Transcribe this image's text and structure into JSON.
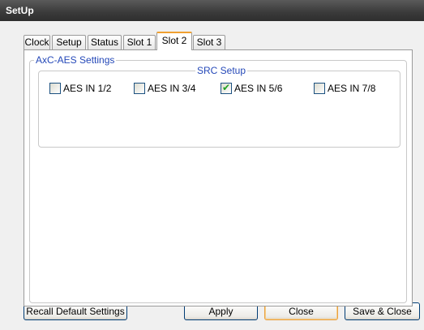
{
  "window": {
    "title": "SetUp"
  },
  "tabs": [
    {
      "label": "Clock"
    },
    {
      "label": "Setup"
    },
    {
      "label": "Status"
    },
    {
      "label": "Slot 1"
    },
    {
      "label": "Slot 2",
      "active": true
    },
    {
      "label": "Slot 3"
    }
  ],
  "panel": {
    "group_title": "AxC-AES Settings",
    "src_group": {
      "title": "SRC Setup",
      "checkboxes": [
        {
          "label": "AES IN 1/2",
          "checked": false
        },
        {
          "label": "AES IN 3/4",
          "checked": false
        },
        {
          "label": "AES IN 5/6",
          "checked": true
        },
        {
          "label": "AES IN 7/8",
          "checked": false
        }
      ]
    }
  },
  "buttons": {
    "recall_label": "Recall Default Settings",
    "apply_label": "Apply",
    "close_label": "Close",
    "save_close_label": "Save & Close"
  },
  "colors": {
    "group_title": "#2448b8",
    "active_tab_accent": "#f0a030",
    "check": "#21a121"
  },
  "icons": {
    "check_mark": "check-icon"
  }
}
